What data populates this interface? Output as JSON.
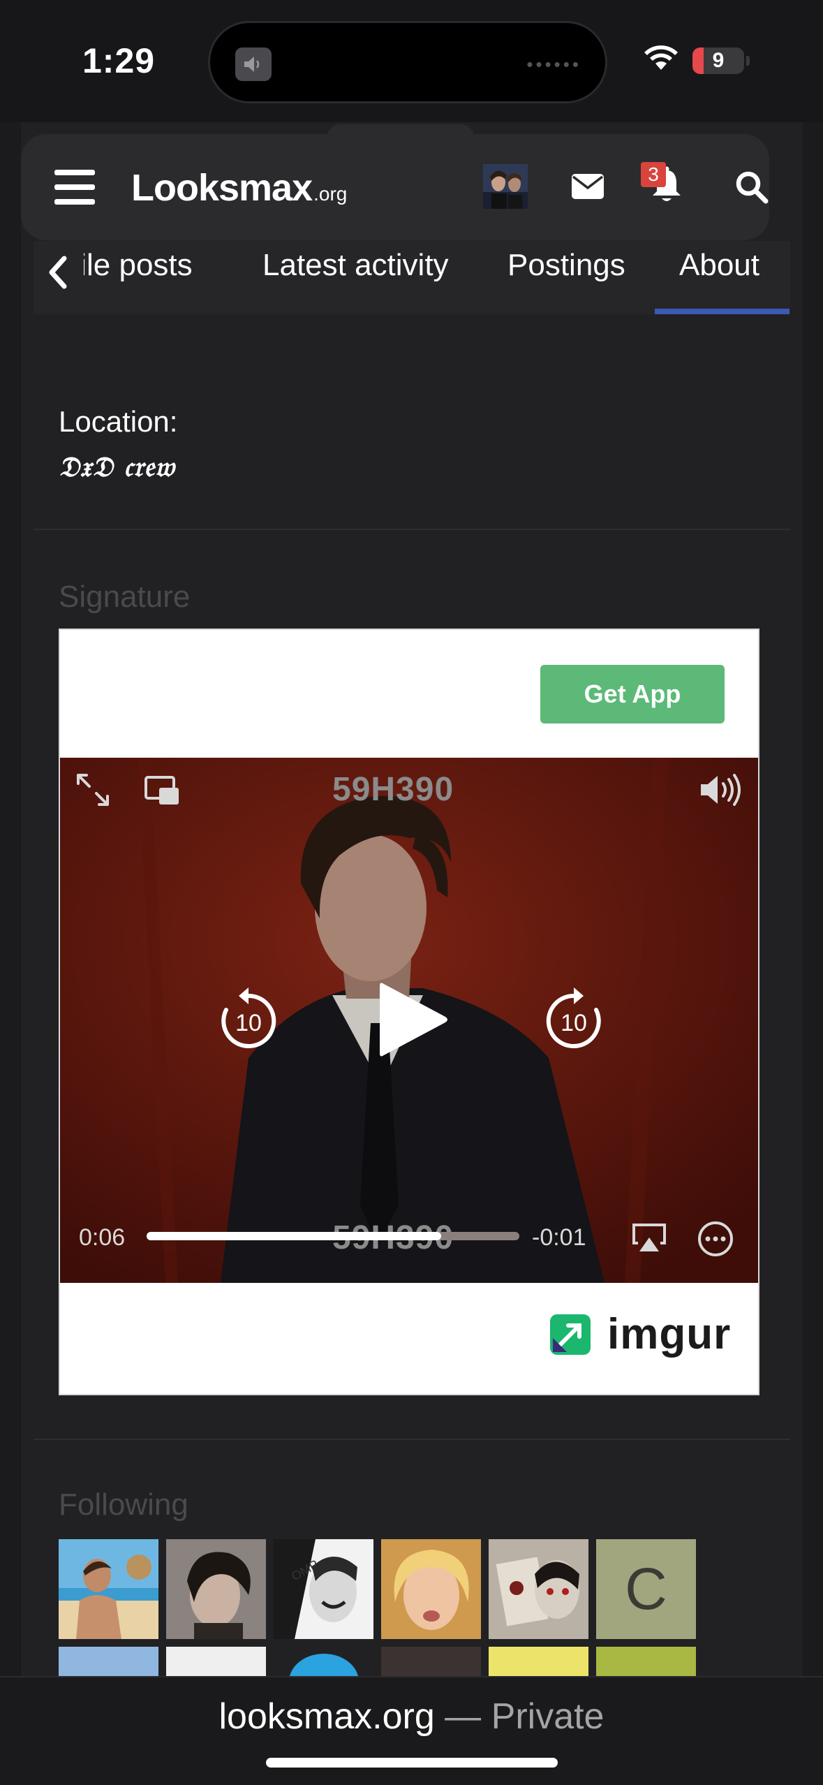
{
  "status_bar": {
    "time": "1:29",
    "battery": "9"
  },
  "header": {
    "logo_main": "Looksmax",
    "logo_suffix": ".org",
    "notification_count": "3"
  },
  "tabs": {
    "items": [
      "file posts",
      "Latest activity",
      "Postings",
      "About"
    ],
    "active": "About"
  },
  "about": {
    "location_label": "Location:",
    "location_value": "𝔇𝔵𝔇 𝔠𝔯𝔢𝔴"
  },
  "signature": {
    "section_title": "Signature",
    "get_app_label": "Get App",
    "video": {
      "watermark": "59H390",
      "elapsed": "0:06",
      "remaining": "-0:01",
      "progress_fraction": 0.79,
      "skip_back": "10",
      "skip_forward": "10"
    },
    "imgur_label": "imgur"
  },
  "following": {
    "section_title": "Following",
    "letter_avatar": "C"
  },
  "browser": {
    "domain": "looksmax.org",
    "separator": " — ",
    "mode": "Private"
  },
  "colors": {
    "accent": "#3b5ab5",
    "get_app": "#5cb978",
    "badge": "#d9443d",
    "background": "#212124"
  }
}
